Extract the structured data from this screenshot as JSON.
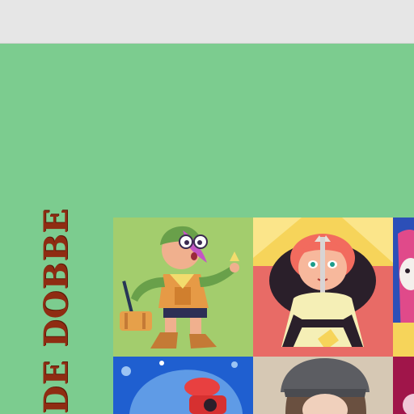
{
  "portfolio": {
    "title": "DE DOBBE"
  },
  "gallery": {
    "tiles": [
      {
        "name": "gallery-tile-elf-adventurer",
        "icon": "elf-adventurer-illustration"
      },
      {
        "name": "gallery-tile-princess",
        "icon": "princess-with-sword-illustration"
      },
      {
        "name": "gallery-tile-blue-character",
        "icon": "blue-character-illustration"
      },
      {
        "name": "gallery-tile-blue-abstract",
        "icon": "blue-abstract-illustration"
      },
      {
        "name": "gallery-tile-portrait-photo",
        "icon": "portrait-photo"
      },
      {
        "name": "gallery-tile-magenta",
        "icon": "magenta-illustration"
      }
    ]
  },
  "colors": {
    "background": "#7ccc8f",
    "topbar": "#e6e6e6",
    "title": "#8f2c12"
  }
}
